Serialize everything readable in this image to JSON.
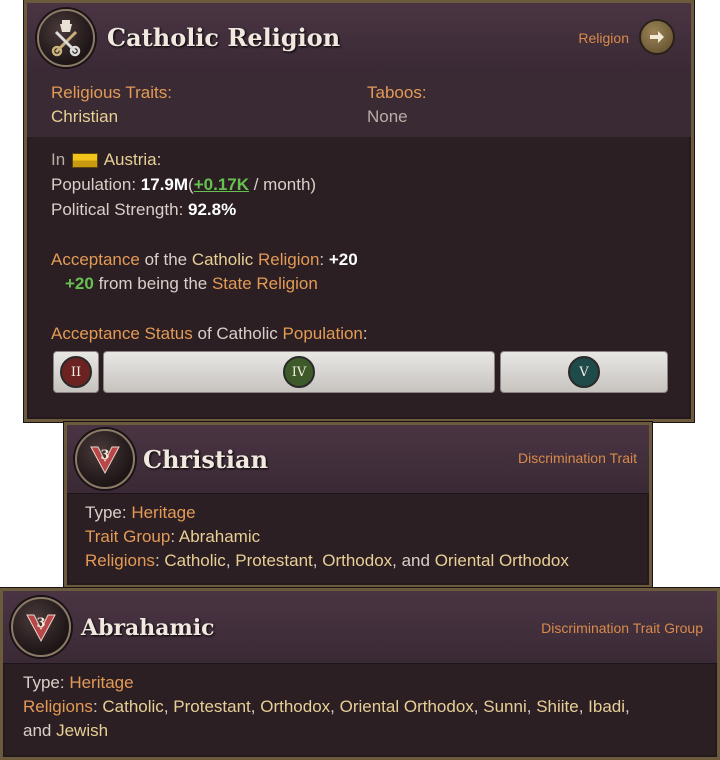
{
  "religion_panel": {
    "title": "Catholic Religion",
    "link_label": "Religion",
    "traits_label": "Religious Traits:",
    "traits_value": "Christian",
    "taboos_label": "Taboos:",
    "taboos_value": "None",
    "in_label": "In",
    "country": "Austria",
    "colon": ":",
    "population_label": "Population: ",
    "population_value": "17.9M",
    "population_change": "+0.17K",
    "population_suffix": " / month)",
    "political_label": "Political Strength: ",
    "political_value": "92.8%",
    "acceptance_word": "Acceptance",
    "acceptance_of_the": " of the ",
    "acceptance_religion_name": "Catholic",
    "acceptance_religion_word": "Religion",
    "acceptance_value": "+20",
    "bonus_value": "+20",
    "bonus_text": " from being the ",
    "bonus_source": "State Religion",
    "status_label": "Acceptance Status",
    "status_of": " of Catholic ",
    "status_population": "Population",
    "status_badges": [
      {
        "numeral": "II",
        "color": "#6a2320"
      },
      {
        "numeral": "IV",
        "color": "#3e5a2a"
      },
      {
        "numeral": "V",
        "color": "#1f4a4a"
      }
    ]
  },
  "christian_panel": {
    "title": "Christian",
    "category": "Discrimination Trait",
    "type_label": "Type: ",
    "type_value": "Heritage",
    "group_label": "Trait Group",
    "group_value": "Abrahamic",
    "religions_label": "Religions",
    "religions": [
      "Catholic",
      "Protestant",
      "Orthodox",
      "Oriental Orthodox"
    ]
  },
  "abrahamic_panel": {
    "title": "Abrahamic",
    "category": "Discrimination Trait Group",
    "type_label": "Type: ",
    "type_value": "Heritage",
    "religions_label": "Religions",
    "religions": [
      "Catholic",
      "Protestant",
      "Orthodox",
      "Oriental Orthodox",
      "Sunni",
      "Shiite",
      "Ibadi",
      "Jewish"
    ]
  },
  "icons": {
    "religion_emblem": "papal-keys-icon",
    "trait_emblem": "v3-logo-icon",
    "link_arrow": "arrow-right-icon",
    "flag": "austria-flag-icon"
  }
}
